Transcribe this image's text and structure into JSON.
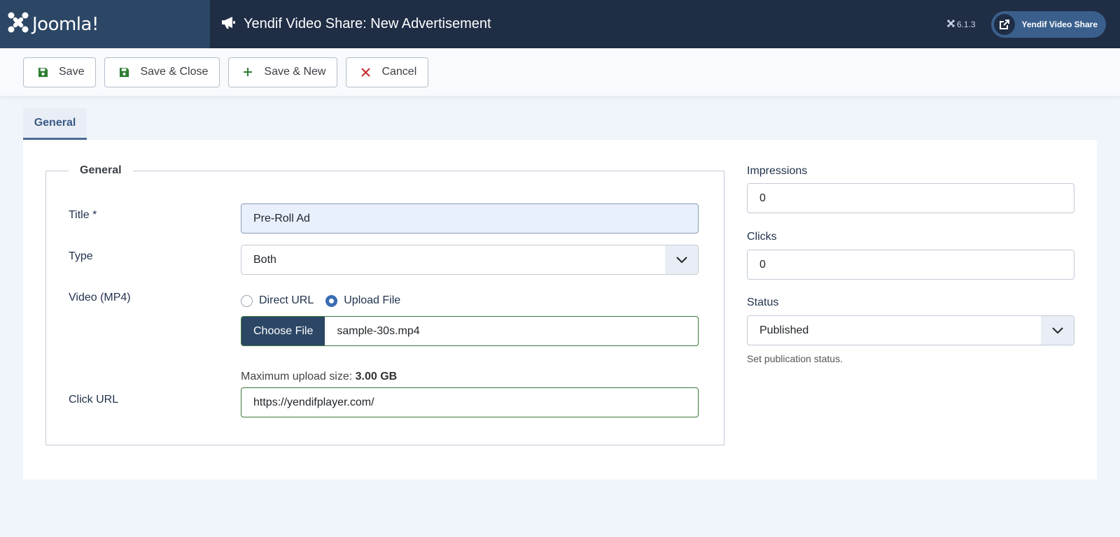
{
  "header": {
    "logo_text": "Joomla!",
    "page_title": "Yendif Video Share: New Advertisement",
    "version": "6.1.3",
    "site_button_label": "Yendif Video Share"
  },
  "toolbar": {
    "save": "Save",
    "save_close": "Save & Close",
    "save_new": "Save & New",
    "cancel": "Cancel"
  },
  "tabs": [
    {
      "label": "General"
    }
  ],
  "form": {
    "legend": "General",
    "title_label": "Title *",
    "title_value": "Pre-Roll Ad",
    "type_label": "Type",
    "type_value": "Both",
    "video_label": "Video (MP4)",
    "radio_direct": "Direct URL",
    "radio_upload": "Upload File",
    "choose_file": "Choose File",
    "file_name": "sample-30s.mp4",
    "max_upload_prefix": "Maximum upload size: ",
    "max_upload_value": "3.00 GB",
    "click_url_label": "Click URL",
    "click_url_value": "https://yendifplayer.com/"
  },
  "sidebar": {
    "impressions_label": "Impressions",
    "impressions_value": "0",
    "clicks_label": "Clicks",
    "clicks_value": "0",
    "status_label": "Status",
    "status_value": "Published",
    "status_desc": "Set publication status."
  },
  "colors": {
    "header_bg": "#1f2d45",
    "logo_bg": "#2c4766",
    "accent": "#3a5a85",
    "save_icon": "#2e7d32",
    "cancel_icon": "#c62828"
  },
  "icons": {
    "logo": "joomla-logo-icon",
    "title": "megaphone-icon",
    "version": "joomla-small-icon",
    "site": "external-link-icon",
    "save": "floppy-disk-icon",
    "new": "plus-icon",
    "cancel": "close-icon",
    "select": "chevron-down-icon"
  }
}
